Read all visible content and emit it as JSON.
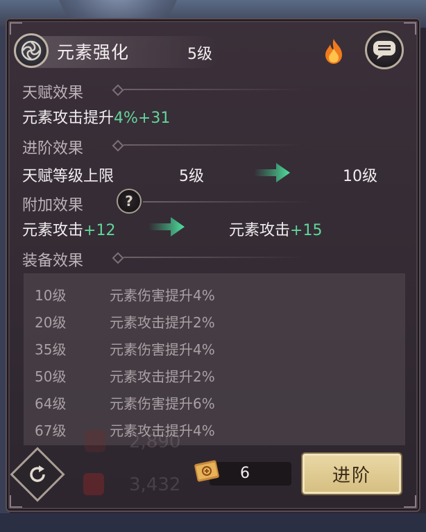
{
  "header": {
    "title": "元素强化",
    "level": "5级",
    "skill_icon": "swirl-icon",
    "fire_icon": "fire-icon",
    "chat_icon": "chat-bubble-icon"
  },
  "sections": {
    "talent": {
      "heading": "天赋效果",
      "line_prefix": "元素攻击提升",
      "line_value": "4%+31"
    },
    "advance": {
      "heading": "进阶效果",
      "label": "天赋等级上限",
      "from": "5级",
      "to": "10级"
    },
    "extra": {
      "heading": "附加效果",
      "from_label": "元素攻击",
      "from_value": "+12",
      "to_label": "元素攻击",
      "to_value": "+15"
    },
    "equip": {
      "heading": "装备效果",
      "rows": [
        {
          "level": "10级",
          "effect": "元素伤害提升4%"
        },
        {
          "level": "20级",
          "effect": "元素攻击提升2%"
        },
        {
          "level": "35级",
          "effect": "元素伤害提升4%"
        },
        {
          "level": "50级",
          "effect": "元素攻击提升2%"
        },
        {
          "level": "64级",
          "effect": "元素伤害提升6%"
        },
        {
          "level": "67级",
          "effect": "元素攻击提升4%"
        }
      ]
    }
  },
  "background_stats": {
    "stat_1": "2,890",
    "stat_2": "3,432"
  },
  "footer": {
    "cost": "6",
    "advance_label": "进阶"
  },
  "colors": {
    "green": "#62d69a",
    "button_gold": "#e0cb93"
  }
}
